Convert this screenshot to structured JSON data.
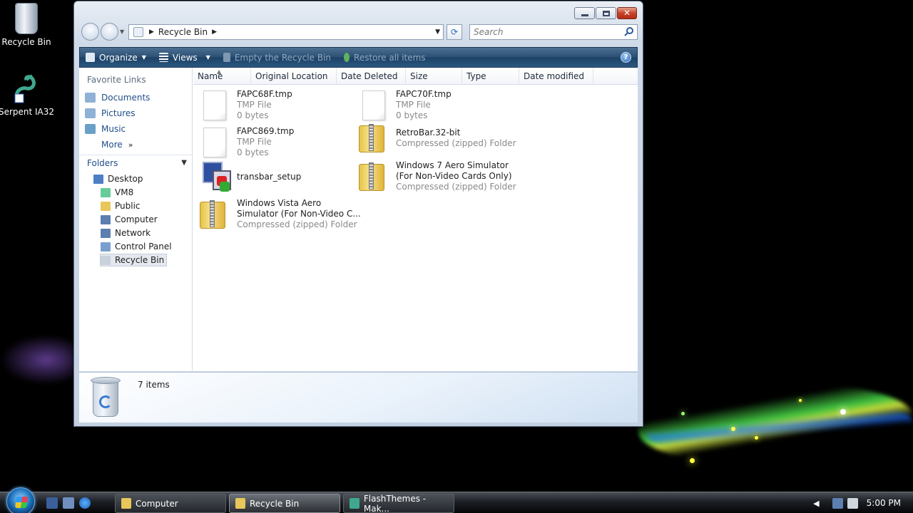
{
  "desktop": {
    "icons": [
      {
        "label": "Recycle Bin"
      },
      {
        "label": "Serpent IA32"
      }
    ]
  },
  "window": {
    "address": {
      "crumb": "Recycle Bin"
    },
    "search": {
      "placeholder": "Search"
    },
    "toolbar": {
      "organize": "Organize",
      "views": "Views",
      "empty": "Empty the Recycle Bin",
      "restore": "Restore all items"
    },
    "favorites": {
      "title": "Favorite Links",
      "items": [
        {
          "label": "Documents"
        },
        {
          "label": "Pictures"
        },
        {
          "label": "Music"
        },
        {
          "label": "More"
        }
      ]
    },
    "folders": {
      "title": "Folders",
      "tree": [
        {
          "label": "Desktop"
        },
        {
          "label": "VM8"
        },
        {
          "label": "Public"
        },
        {
          "label": "Computer"
        },
        {
          "label": "Network"
        },
        {
          "label": "Control Panel"
        },
        {
          "label": "Recycle Bin"
        }
      ]
    },
    "columns": [
      "Name",
      "Original Location",
      "Date Deleted",
      "Size",
      "Type",
      "Date modified"
    ],
    "files": [
      {
        "name": "FAPC68F.tmp",
        "line2": "TMP File",
        "line3": "0 bytes"
      },
      {
        "name": "FAPC70F.tmp",
        "line2": "TMP File",
        "line3": "0 bytes"
      },
      {
        "name": "FAPC869.tmp",
        "line2": "TMP File",
        "line3": "0 bytes"
      },
      {
        "name": "RetroBar.32-bit",
        "line2": "Compressed (zipped) Folder"
      },
      {
        "name": "transbar_setup"
      },
      {
        "name": "Windows 7 Aero Simulator",
        "line2": "(For Non-Video Cards Only)",
        "line3": "Compressed (zipped) Folder"
      },
      {
        "name": "Windows Vista Aero",
        "line2": "Simulator (For Non-Video C...",
        "line3": "Compressed (zipped) Folder"
      }
    ],
    "details": {
      "count": "7 items"
    }
  },
  "taskbar": {
    "tasks": [
      {
        "label": "Computer"
      },
      {
        "label": "Recycle Bin"
      },
      {
        "label": "FlashThemes - Mak..."
      }
    ],
    "clock": "5:00 PM"
  },
  "colors": {
    "toolbar": "#2b4f73",
    "link": "#1f4d8a",
    "close": "#c7432a"
  }
}
